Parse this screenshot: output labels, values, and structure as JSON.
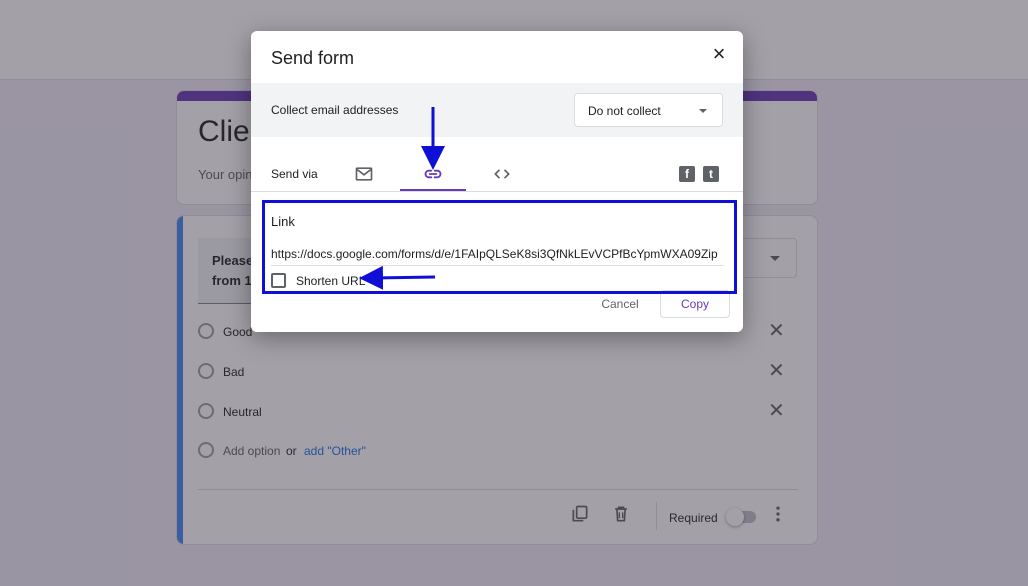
{
  "background": {
    "form_title": "Clien",
    "form_description": "Your opini",
    "question": {
      "title_line1": "Please",
      "title_line2": "from 1",
      "options": [
        {
          "label": "Good"
        },
        {
          "label": "Bad"
        },
        {
          "label": "Neutral"
        }
      ],
      "add_option_label": "Add option",
      "or_text": "or",
      "add_other_label": "add \"Other\"",
      "required_label": "Required"
    }
  },
  "dialog": {
    "title": "Send form",
    "close_icon": "×",
    "collect_label": "Collect email addresses",
    "collect_select_value": "Do not collect",
    "send_via_label": "Send via",
    "tabs": [
      {
        "name": "email",
        "icon": "mail-icon"
      },
      {
        "name": "link",
        "icon": "link-icon",
        "active": true
      },
      {
        "name": "embed",
        "icon": "code-icon"
      }
    ],
    "social": {
      "facebook": "f",
      "twitter": "t"
    },
    "link_label": "Link",
    "link_url": "https://docs.google.com/forms/d/e/1FAIpQLSeK8si3QfNkLEvVCPfBcYpmWXA09Zip",
    "shorten_label": "Shorten URL",
    "cancel_label": "Cancel",
    "copy_label": "Copy"
  },
  "colors": {
    "accent": "#673ab7",
    "question_accent": "#4285f4",
    "annotation": "#0f0fd6"
  }
}
